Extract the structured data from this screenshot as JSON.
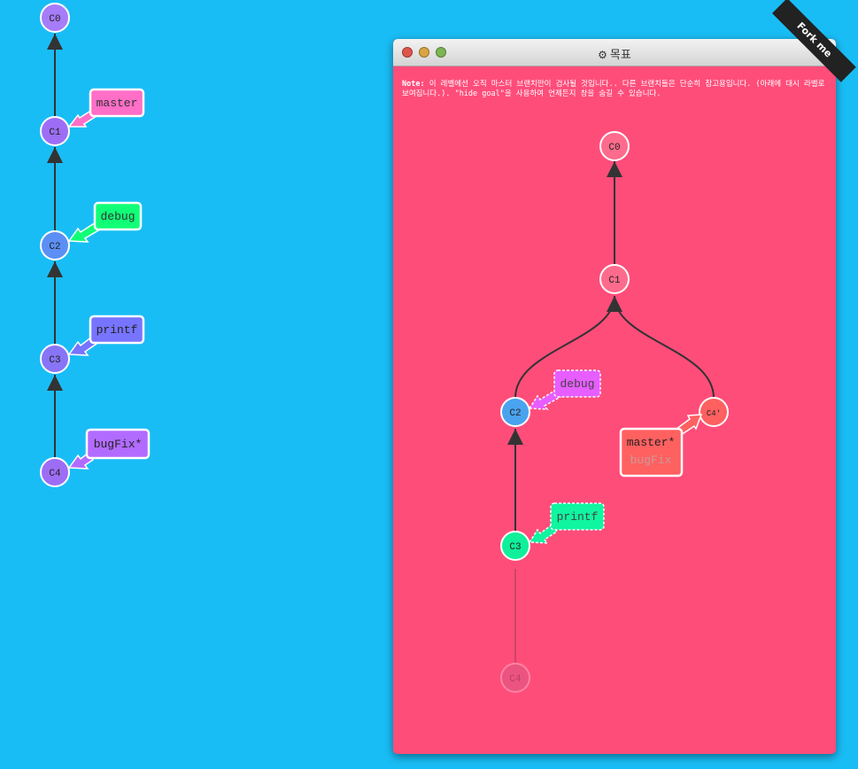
{
  "ribbon": {
    "label": "Fork me"
  },
  "current_tree": {
    "commits": [
      "C0",
      "C1",
      "C2",
      "C3",
      "C4"
    ],
    "branches": [
      "master",
      "debug",
      "printf",
      "bugFix*"
    ]
  },
  "goal_window": {
    "title": "목표",
    "note_prefix": "Note:",
    "note": "이 레벨에선 오직 마스터 브랜치만이 검사될 것입니다.. 다른 브랜치들은 단순히 참고용입니다. (아래에 대시 라벨로 보여집니다.). \"hide goal\"을 사용하여 언제든지 창을 숨길 수 있습니다.",
    "commits": [
      "C0",
      "C1",
      "C2",
      "C3",
      "C4'",
      "C4"
    ],
    "branches": [
      "debug",
      "printf",
      "master*",
      "bugFix"
    ]
  },
  "colors": {
    "background": "#19bdf5",
    "goal_background": "#ff4d7a",
    "master": "#ff6ec7",
    "debug": "#11ff77",
    "printf": "#7774ff",
    "bugFix": "#b26bff",
    "goal_debug": "#e85dff",
    "goal_printf": "#10f5a0",
    "goal_master": "#ff6060"
  }
}
